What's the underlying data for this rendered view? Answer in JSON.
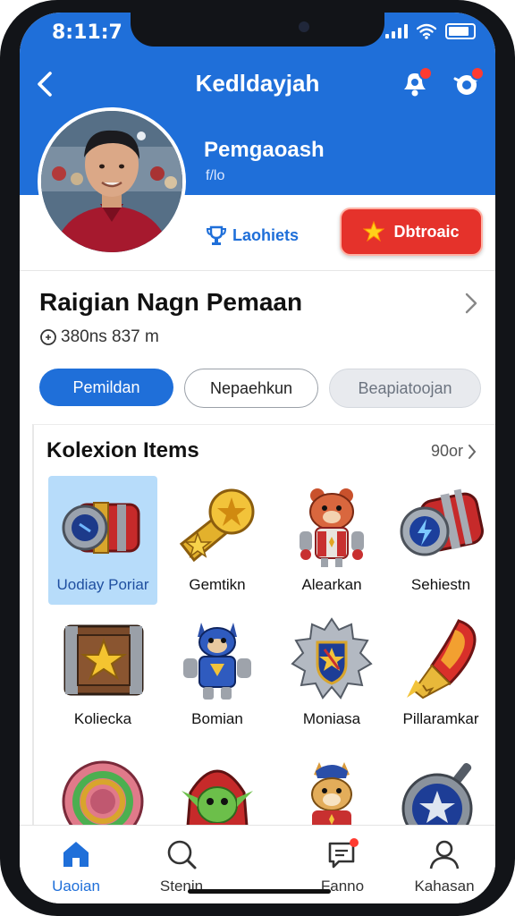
{
  "status": {
    "time": "8:11:7"
  },
  "header": {
    "title": "Kedldayjah"
  },
  "profile": {
    "name": "Pemgaoash",
    "subtitle": "f/lo",
    "secondary_button": "Laohiets",
    "primary_button": "Dbtroaic"
  },
  "section": {
    "title": "Raigian Nagn Pemaan",
    "meta": "380ns 837 m"
  },
  "filters": {
    "active": "Pemildan",
    "outline": "Nepaehkun",
    "muted": "Beapiatoojan"
  },
  "collection": {
    "title": "Kolexion Items",
    "see_all": "90or",
    "items": [
      {
        "label": "Uodiay Poriar",
        "icon": "cannon-barrel-icon"
      },
      {
        "label": "Gemtikn",
        "icon": "star-medal-icon"
      },
      {
        "label": "Alearkan",
        "icon": "bear-robot-icon"
      },
      {
        "label": "Sehiestn",
        "icon": "lightning-capsule-icon"
      },
      {
        "label": "Koliecka",
        "icon": "star-chest-icon"
      },
      {
        "label": "Bomian",
        "icon": "armored-cat-icon"
      },
      {
        "label": "Moniasa",
        "icon": "shield-emblem-icon"
      },
      {
        "label": "Pillaramkar",
        "icon": "flame-scroll-icon"
      },
      {
        "label": "",
        "icon": "ring-orb-icon"
      },
      {
        "label": "",
        "icon": "green-goblin-icon"
      },
      {
        "label": "",
        "icon": "fox-pilot-icon"
      },
      {
        "label": "",
        "icon": "star-frying-pan-icon"
      }
    ]
  },
  "nav": [
    {
      "label": "Uaoian",
      "icon": "home-icon"
    },
    {
      "label": "Stenin",
      "icon": "search-icon"
    },
    {
      "label": "Fanno",
      "icon": "chat-icon"
    },
    {
      "label": "Kahasan",
      "icon": "profile-icon"
    }
  ],
  "colors": {
    "brand_blue": "#1f6fd9",
    "accent_red": "#e5322b",
    "selected_tile": "#b7dcfa"
  }
}
